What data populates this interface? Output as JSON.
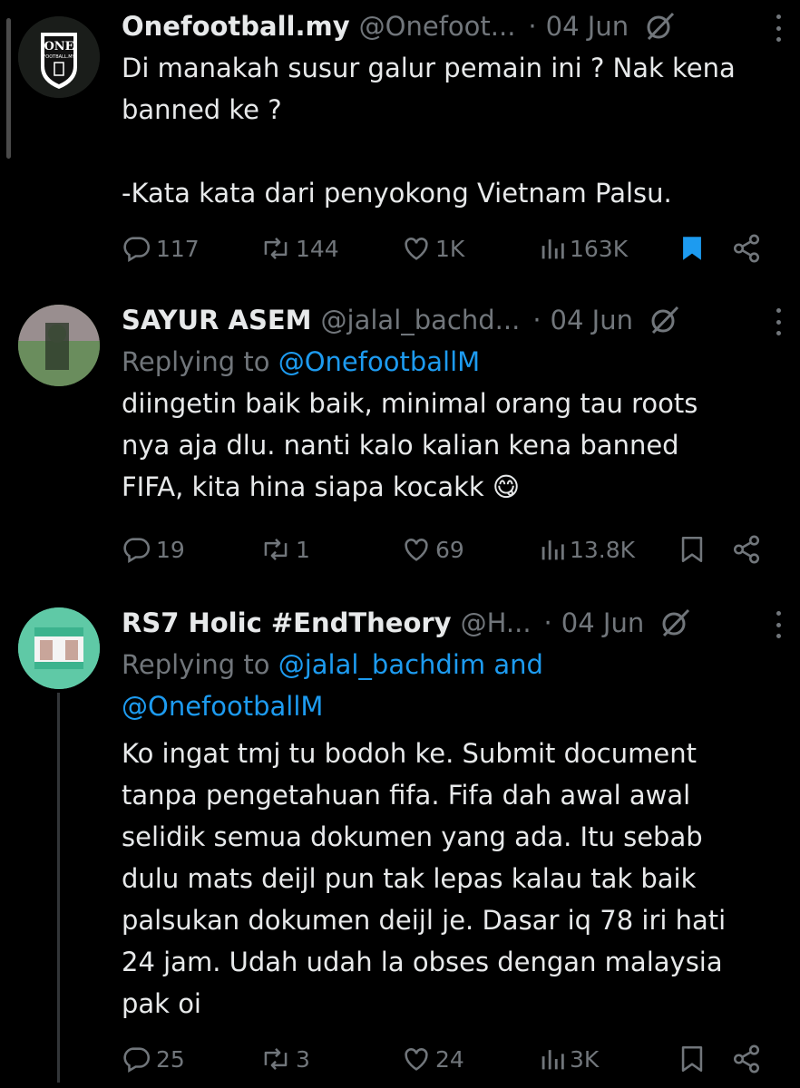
{
  "tweets": [
    {
      "display_name": "Onefootball.my",
      "handle": "@Onefoot...",
      "dot": "·",
      "date": "04 Jun",
      "body": "Di manakah susur galur pemain ini ? Nak kena\nbanned ke ?\n\n-Kata kata dari penyokong Vietnam Palsu.",
      "avatar_text": {
        "top": "ONE",
        "sub": "FOOTBALL.MY"
      },
      "avatar_colors": {
        "bg": "#1a1d1a",
        "logo": "#ffffff"
      },
      "stats": {
        "replies": "117",
        "reposts": "144",
        "likes": "1K",
        "views": "163K"
      },
      "bookmarked": true
    },
    {
      "display_name": "SAYUR ASEM",
      "handle": "@jalal_bachd...",
      "dot": "·",
      "date": "04 Jun",
      "replying_to_label": "Replying to",
      "replying_to_links": "@OnefootballM",
      "body": "diingetin baik baik, minimal orang tau roots\nnya aja dlu. nanti kalo kalian kena banned\nFIFA, kita hina siapa kocakk 😋",
      "avatar_colors": {
        "bg": "#6b8f5e"
      },
      "stats": {
        "replies": "19",
        "reposts": "1",
        "likes": "69",
        "views": "13.8K"
      },
      "bookmarked": false
    },
    {
      "display_name": "RS7 Holic #EndTheory",
      "handle": "@H...",
      "dot": "·",
      "date": "04 Jun",
      "replying_to_label": "Replying to",
      "replying_to_links": "@jalal_bachdim and\n@OnefootballM",
      "body": "Ko ingat tmj tu bodoh ke. Submit document\ntanpa pengetahuan fifa. Fifa dah awal awal\nselidik semua dokumen yang ada. Itu sebab\ndulu mats deijl pun tak lepas kalau tak baik\npalsukan dokumen deijl je. Dasar iq 78 iri hati\n24 jam. Udah udah la obses dengan malaysia\npak oi",
      "avatar_colors": {
        "bg": "#5fc9a6"
      },
      "stats": {
        "replies": "25",
        "reposts": "3",
        "likes": "24",
        "views": "3K"
      },
      "bookmarked": false
    }
  ],
  "colors": {
    "background": "#000000",
    "text": "#e7e9ea",
    "muted": "#71767b",
    "link": "#1d9bf0",
    "bookmark_active": "#1d9bf0"
  }
}
